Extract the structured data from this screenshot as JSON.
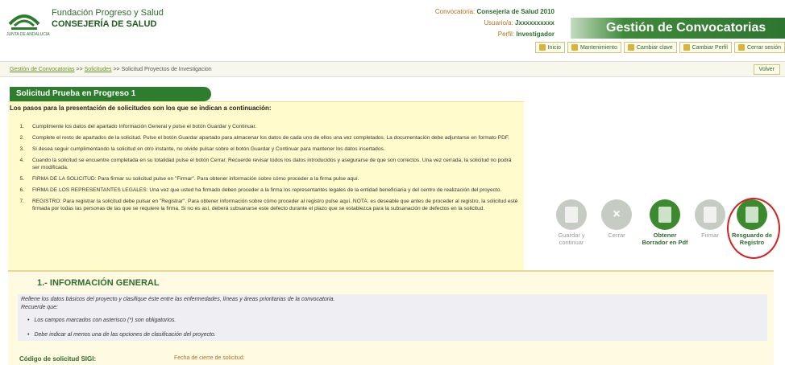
{
  "header": {
    "org_line1": "Fundación Progreso y Salud",
    "org_line2": "CONSEJERÍA DE SALUD",
    "logo_sub": "JUNTA DE ANDALUCIA",
    "convocatoria_label": "Convocatoria:",
    "convocatoria_value": "Consejería de Salud 2010",
    "usuario_label": "Usuario/a:",
    "usuario_value": "Jxxxxxxxxxx",
    "perfil_label": "Perfil:",
    "perfil_value": "Investigador",
    "banner_title": "Gestión de Convocatorias"
  },
  "toolbar": [
    {
      "label": "Inicio",
      "icon": "home-icon"
    },
    {
      "label": "Mantenimiento",
      "icon": "wrench-icon"
    },
    {
      "label": "Cambiar clave",
      "icon": "key-icon"
    },
    {
      "label": "Cambiar Perfil",
      "icon": "user-icon"
    },
    {
      "label": "Cerrar sesión",
      "icon": "exit-icon"
    }
  ],
  "breadcrumb": {
    "item1": "Gestión de Convocatorias",
    "sep": ">>",
    "item2": "Solicitudes",
    "item3": "Solicitud Proyectos de Investigacion"
  },
  "volver_label": "Volver",
  "page_title": "Solicitud Prueba en Progreso 1",
  "intro": "Los pasos para la presentación de solicitudes son los que se indican a continuación:",
  "steps": [
    {
      "n": "1.",
      "text": "Cumplimente los datos del apartado Información General y pulse el botón Guardar y Continuar."
    },
    {
      "n": "2.",
      "text": "Complete el resto de apartados de la solicitud. Pulse el botón Guardar apartado para almacenar los datos de cada uno de ellos una vez completados. La documentación debe adjuntarse en formato PDF."
    },
    {
      "n": "3.",
      "text": "Si desea seguir cumplimentando la solicitud en otro instante, no olvide pulsar sobre el botón Guardar y Continuar para mantener los datos insertados."
    },
    {
      "n": "4.",
      "text": "Cuando la solicitud se encuentre completada en su totalidad pulse el botón Cerrar. Recuerde revisar todos los datos introducidos y asegurarse de que son correctos. Una vez cerrada, la solicitud no podrá ser modificada."
    },
    {
      "n": "5.",
      "text": "FIRMA DE LA SOLICITUD: Para firmar su solicitud pulse en \"Firmar\". Para obtener información sobre cómo proceder a la firma pulse aquí."
    },
    {
      "n": "6.",
      "text": "FIRMA DE LOS REPRESENTANTES LEGALES: Una vez que usted ha firmado deben proceder a la firma los representantes legales de la entidad beneficiaria y del centro de realización del proyecto."
    },
    {
      "n": "7.",
      "text": "REGISTRO: Para registrar la solicitud debe pulsar en \"Registrar\". Para obtener información sobre cómo proceder al registro pulse aquí. NOTA: es deseable que antes de proceder al registro, la solicitud esté firmada por todas las personas de las que se requiere la firma. Si no es así, deberá subsanarse este defecto durante el plazo que se establezca para la subsanación de defectos en la solicitud."
    }
  ],
  "actions": [
    {
      "label": "Guardar y continuar",
      "enabled": false,
      "icon": "save-icon"
    },
    {
      "label": "Cerrar",
      "enabled": false,
      "icon": "close-icon"
    },
    {
      "label": "Obtener Borrador en Pdf",
      "enabled": true,
      "icon": "pdf-icon"
    },
    {
      "label": "Firmar",
      "enabled": false,
      "icon": "sign-icon"
    },
    {
      "label": "Resguardo de Registro",
      "enabled": true,
      "icon": "receipt-icon"
    }
  ],
  "section": {
    "title": "1.- INFORMACIÓN GENERAL",
    "desc": "Rellene los datos básicos del proyecto y clasifique éste entre las enfermedades, líneas y áreas prioritarias de la convocatoria.",
    "recuerde": "Recuerde que:",
    "bullets": [
      "Los campos marcados con asterisco (*) son obligatorios.",
      "Debe indicar al menos una de las opciones de clasificación del proyecto."
    ],
    "codigo_label": "Código de solicitud SIGI:",
    "fecha_label": "Fecha de cierre de solicitud:"
  },
  "colors": {
    "brand_green": "#2e7d2e",
    "highlight_red": "#d81e1e",
    "steps_bg": "#fffbcc"
  }
}
